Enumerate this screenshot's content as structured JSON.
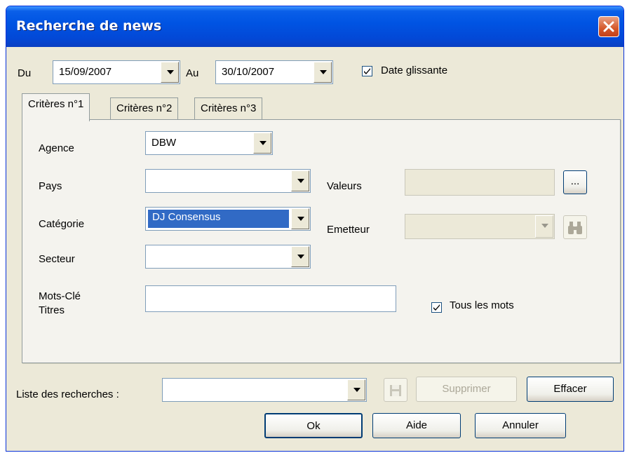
{
  "window": {
    "title": "Recherche de news",
    "close_icon": "close-icon"
  },
  "dates": {
    "from_label": "Du",
    "from_value": "15/09/2007",
    "to_label": "Au",
    "to_value": "30/10/2007",
    "sliding_label": "Date glissante",
    "sliding_checked": true
  },
  "tabs": [
    {
      "label": "Critères n°1",
      "active": true
    },
    {
      "label": "Critères n°2",
      "active": false
    },
    {
      "label": "Critères n°3",
      "active": false
    }
  ],
  "criteria": {
    "agence_label": "Agence",
    "agence_value": "DBW",
    "pays_label": "Pays",
    "pays_value": "",
    "categorie_label": "Catégorie",
    "categorie_value": "DJ Consensus",
    "secteur_label": "Secteur",
    "secteur_value": "",
    "keywords_label_line1": "Mots-Clé",
    "keywords_label_line2": "Titres",
    "keywords_value": "",
    "valeurs_label": "Valeurs",
    "valeurs_value": "",
    "valeurs_browse_label": "...",
    "emetteur_label": "Emetteur",
    "emetteur_value": "",
    "emetteur_search_icon": "binoculars-icon",
    "all_words_label": "Tous les mots",
    "all_words_checked": true
  },
  "searches": {
    "list_label": "Liste des recherches :",
    "list_value": "",
    "save_icon": "save-icon",
    "delete_label": "Supprimer",
    "clear_label": "Effacer"
  },
  "footer": {
    "ok_label": "Ok",
    "help_label": "Aide",
    "cancel_label": "Annuler"
  },
  "colors": {
    "titlebar": "#0054e3",
    "dialog_bg": "#ece9d8",
    "selection": "#316ac5",
    "close_button": "#d5582a"
  }
}
